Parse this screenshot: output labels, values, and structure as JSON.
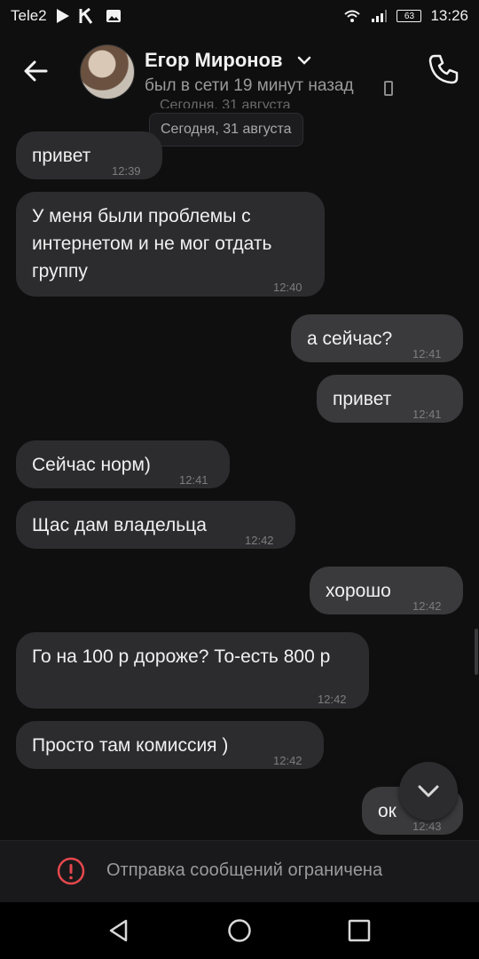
{
  "status_bar": {
    "carrier": "Tele2",
    "battery": "63",
    "time": "13:26"
  },
  "header": {
    "name": "Егор Миронов",
    "status": "был в сети 19 минут назад"
  },
  "date_ghost": "Сегодня, 31 августа",
  "date_pill": "Сегодня, 31 августа",
  "messages": [
    {
      "text": "привет",
      "time": "12:39",
      "dir": "in"
    },
    {
      "text": "У меня были проблемы с интернетом и не мог отдать группу",
      "time": "12:40",
      "dir": "in"
    },
    {
      "text": "а сейчас?",
      "time": "12:41",
      "dir": "out"
    },
    {
      "text": "привет",
      "time": "12:41",
      "dir": "out"
    },
    {
      "text": "Сейчас норм)",
      "time": "12:41",
      "dir": "in"
    },
    {
      "text": "Щас дам владельца",
      "time": "12:42",
      "dir": "in"
    },
    {
      "text": "хорошо",
      "time": "12:42",
      "dir": "out"
    },
    {
      "text": "Го на 100 р дороже? То-есть 800 р",
      "time": "12:42",
      "dir": "in"
    },
    {
      "text": "Просто там комиссия )",
      "time": "12:42",
      "dir": "in"
    },
    {
      "text": "ок",
      "time": "12:43",
      "dir": "out"
    }
  ],
  "composer": {
    "restricted_text": "Отправка сообщений ограничена",
    "warning_color": "#e5484d"
  }
}
